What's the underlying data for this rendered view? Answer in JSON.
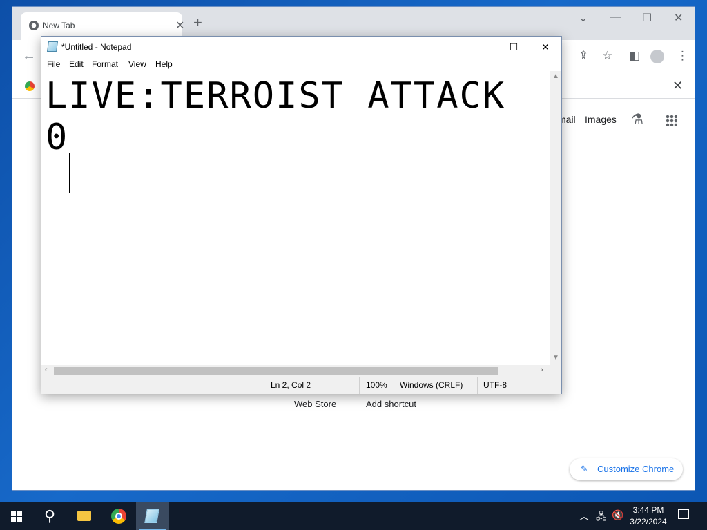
{
  "chrome": {
    "tab_title": "New Tab",
    "gmail_link": "mail",
    "images_link": "Images",
    "shortcuts": [
      "Web Store",
      "Add shortcut"
    ],
    "customize_label": "Customize Chrome",
    "accent_color": "#1a73e8"
  },
  "notepad": {
    "title": "*Untitled - Notepad",
    "menu": [
      "File",
      "Edit",
      "Format",
      "View",
      "Help"
    ],
    "text_lines": [
      "LIVE:TERROIST ATTACK",
      "0"
    ],
    "status": {
      "position": "Ln 2, Col 2",
      "zoom": "100%",
      "line_ending": "Windows (CRLF)",
      "encoding": "UTF-8"
    }
  },
  "taskbar": {
    "time": "3:44 PM",
    "date": "3/22/2024"
  }
}
